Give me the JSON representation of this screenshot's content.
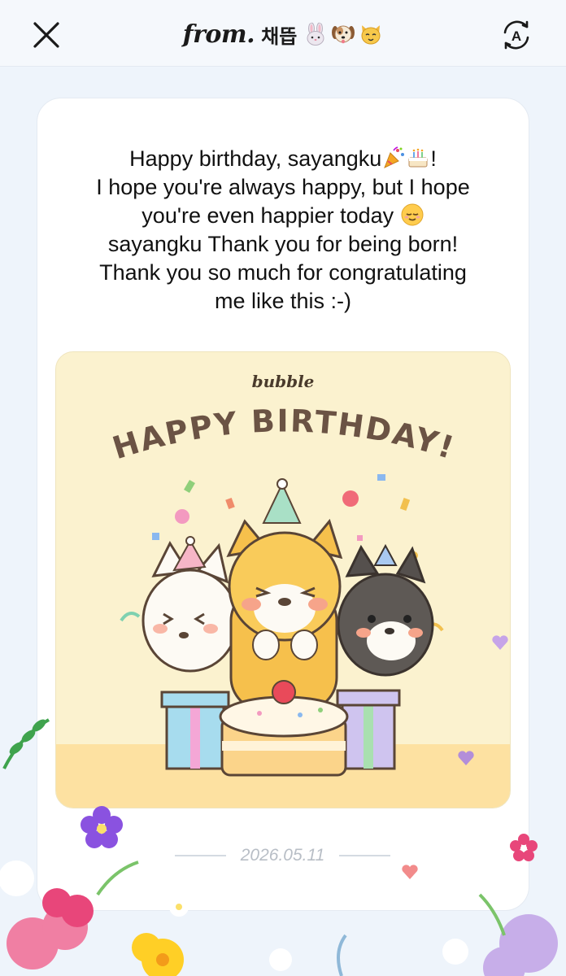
{
  "header": {
    "from_label": "from.",
    "sender_name": "채뜹",
    "sender_emojis": [
      "rabbit-face",
      "dog-face",
      "cat-face"
    ]
  },
  "message": {
    "lines": [
      "Happy birthday, sayangku",
      "I hope you're always happy, but I hope",
      "you're even happier today",
      "sayangku Thank you for being born!",
      "Thank you so much for congratulating",
      "me like this :-)"
    ],
    "line1_suffix": "!",
    "inline_icons": [
      "party-popper-icon",
      "birthday-cake-icon",
      "relieved-face-icon"
    ]
  },
  "sticker": {
    "brand": "bubble",
    "headline": "HAPPY BIRTHDAY!"
  },
  "date": "2026.05.11",
  "colors": {
    "background": "#eef4fb",
    "card": "#ffffff",
    "sticker_bg": "#fbf2cf",
    "headline": "#6b5344"
  }
}
